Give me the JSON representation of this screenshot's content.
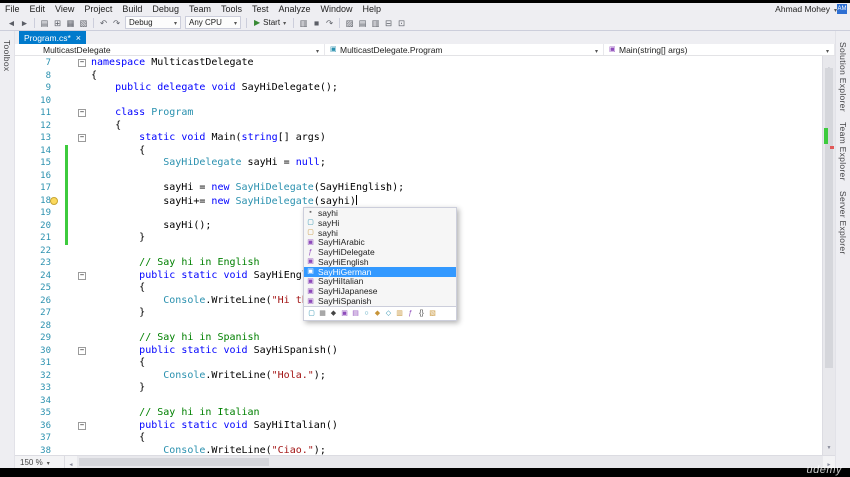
{
  "app": {
    "user_name": "Ahmad Mohey",
    "avatar_initials": "AM",
    "watermark": "udemy"
  },
  "menu_bar": {
    "items": [
      "File",
      "Edit",
      "View",
      "Project",
      "Build",
      "Debug",
      "Team",
      "Tools",
      "Test",
      "Analyze",
      "Window",
      "Help"
    ]
  },
  "toolbar": {
    "debug_target": "Debug",
    "platform": "Any CPU",
    "start_label": "Start",
    "icon_groups": {
      "nav": [
        {
          "name": "nav-back",
          "glyph": "◄"
        },
        {
          "name": "nav-forward",
          "glyph": "►"
        }
      ],
      "file": [
        {
          "name": "new-file",
          "glyph": "▤"
        },
        {
          "name": "open-file",
          "glyph": "⊞"
        },
        {
          "name": "save",
          "glyph": "▦"
        },
        {
          "name": "save-all",
          "glyph": "▧"
        }
      ],
      "edit": [
        {
          "name": "undo",
          "glyph": "↶"
        },
        {
          "name": "redo",
          "glyph": "↷"
        }
      ],
      "after-start": [
        {
          "name": "pause",
          "glyph": "▥"
        },
        {
          "name": "stop",
          "glyph": "■"
        },
        {
          "name": "restart",
          "glyph": "↷"
        }
      ],
      "misc": [
        {
          "name": "find-in-files",
          "glyph": "▨"
        },
        {
          "name": "comment-out",
          "glyph": "▤"
        },
        {
          "name": "uncomment",
          "glyph": "▥"
        },
        {
          "name": "bookmark",
          "glyph": "⊟"
        },
        {
          "name": "navigate-bookmarks",
          "glyph": "⊡"
        }
      ]
    }
  },
  "document_tab": {
    "title": "Program.cs*"
  },
  "breadcrumb": {
    "project": "MulticastDelegate",
    "type": "MulticastDelegate.Program",
    "member": "Main(string[] args)"
  },
  "side_panels": {
    "left": [
      "Toolbox"
    ],
    "right": [
      "Solution Explorer",
      "Team Explorer",
      "Server Explorer"
    ]
  },
  "status": {
    "zoom": "150 %"
  },
  "colors": {
    "accent": "#007acc",
    "keyword": "#0000ff",
    "user_type": "#2b91af",
    "string": "#a31515",
    "comment": "#008000",
    "line_number": "#2b91af",
    "change_bar": "#3dcb3d",
    "selection": "#3399ff"
  },
  "editor": {
    "lines": [
      {
        "n": 7,
        "fold": true,
        "segs": [
          [
            "k",
            "namespace"
          ],
          [
            "p",
            " MulticastDelegate"
          ]
        ]
      },
      {
        "n": 8,
        "segs": [
          [
            "p",
            "{"
          ]
        ]
      },
      {
        "n": 9,
        "segs": [
          [
            "p",
            "    "
          ],
          [
            "k",
            "public"
          ],
          [
            "p",
            " "
          ],
          [
            "k",
            "delegate"
          ],
          [
            "p",
            " "
          ],
          [
            "k",
            "void"
          ],
          [
            "p",
            " SayHiDelegate();"
          ]
        ]
      },
      {
        "n": 10,
        "segs": []
      },
      {
        "n": 11,
        "fold": true,
        "segs": [
          [
            "p",
            "    "
          ],
          [
            "k",
            "class"
          ],
          [
            "p",
            " "
          ],
          [
            "t",
            "Program"
          ]
        ]
      },
      {
        "n": 12,
        "segs": [
          [
            "p",
            "    {"
          ]
        ]
      },
      {
        "n": 13,
        "fold": true,
        "segs": [
          [
            "p",
            "        "
          ],
          [
            "k",
            "static"
          ],
          [
            "p",
            " "
          ],
          [
            "k",
            "void"
          ],
          [
            "p",
            " Main("
          ],
          [
            "k",
            "string"
          ],
          [
            "p",
            "[] args)"
          ]
        ]
      },
      {
        "n": 14,
        "change": true,
        "segs": [
          [
            "p",
            "        {"
          ]
        ]
      },
      {
        "n": 15,
        "change": true,
        "segs": [
          [
            "p",
            "            "
          ],
          [
            "t",
            "SayHiDelegate"
          ],
          [
            "p",
            " sayHi = "
          ],
          [
            "k",
            "null"
          ],
          [
            "p",
            ";"
          ]
        ]
      },
      {
        "n": 16,
        "change": true,
        "segs": []
      },
      {
        "n": 17,
        "change": true,
        "segs": [
          [
            "p",
            "            sayHi = "
          ],
          [
            "k",
            "new"
          ],
          [
            "p",
            " "
          ],
          [
            "t",
            "SayHiDelegate"
          ],
          [
            "p",
            "(SayHiEnglish);"
          ]
        ]
      },
      {
        "n": 18,
        "change": true,
        "bulb": true,
        "caret": true,
        "segs": [
          [
            "p",
            "            sayHi+= "
          ],
          [
            "k",
            "new"
          ],
          [
            "p",
            " "
          ],
          [
            "t",
            "SayHiDelegate"
          ],
          [
            "p",
            "(sayhi)"
          ]
        ]
      },
      {
        "n": 19,
        "change": true,
        "segs": []
      },
      {
        "n": 20,
        "change": true,
        "segs": [
          [
            "p",
            "            sayHi();"
          ]
        ]
      },
      {
        "n": 21,
        "change": true,
        "segs": [
          [
            "p",
            "        }"
          ]
        ]
      },
      {
        "n": 22,
        "segs": []
      },
      {
        "n": 23,
        "segs": [
          [
            "p",
            "        "
          ],
          [
            "c",
            "// Say hi in English"
          ]
        ]
      },
      {
        "n": 24,
        "fold": true,
        "segs": [
          [
            "p",
            "        "
          ],
          [
            "k",
            "public"
          ],
          [
            "p",
            " "
          ],
          [
            "k",
            "static"
          ],
          [
            "p",
            " "
          ],
          [
            "k",
            "void"
          ],
          [
            "p",
            " SayHiEnglish()"
          ]
        ]
      },
      {
        "n": 25,
        "segs": [
          [
            "p",
            "        {"
          ]
        ]
      },
      {
        "n": 26,
        "segs": [
          [
            "p",
            "            "
          ],
          [
            "t",
            "Console"
          ],
          [
            "p",
            ".WriteLine("
          ],
          [
            "s",
            "\"Hi there.\""
          ],
          [
            "p",
            ");"
          ]
        ]
      },
      {
        "n": 27,
        "segs": [
          [
            "p",
            "        }"
          ]
        ]
      },
      {
        "n": 28,
        "segs": []
      },
      {
        "n": 29,
        "segs": [
          [
            "p",
            "        "
          ],
          [
            "c",
            "// Say hi in Spanish"
          ]
        ]
      },
      {
        "n": 30,
        "fold": true,
        "segs": [
          [
            "p",
            "        "
          ],
          [
            "k",
            "public"
          ],
          [
            "p",
            " "
          ],
          [
            "k",
            "static"
          ],
          [
            "p",
            " "
          ],
          [
            "k",
            "void"
          ],
          [
            "p",
            " SayHiSpanish()"
          ]
        ]
      },
      {
        "n": 31,
        "segs": [
          [
            "p",
            "        {"
          ]
        ]
      },
      {
        "n": 32,
        "segs": [
          [
            "p",
            "            "
          ],
          [
            "t",
            "Console"
          ],
          [
            "p",
            ".WriteLine("
          ],
          [
            "s",
            "\"Hola.\""
          ],
          [
            "p",
            ");"
          ]
        ]
      },
      {
        "n": 33,
        "segs": [
          [
            "p",
            "        }"
          ]
        ]
      },
      {
        "n": 34,
        "segs": []
      },
      {
        "n": 35,
        "segs": [
          [
            "p",
            "        "
          ],
          [
            "c",
            "// Say hi in Italian"
          ]
        ]
      },
      {
        "n": 36,
        "fold": true,
        "segs": [
          [
            "p",
            "        "
          ],
          [
            "k",
            "public"
          ],
          [
            "p",
            " "
          ],
          [
            "k",
            "static"
          ],
          [
            "p",
            " "
          ],
          [
            "k",
            "void"
          ],
          [
            "p",
            " SayHiItalian()"
          ]
        ]
      },
      {
        "n": 37,
        "segs": [
          [
            "p",
            "        {"
          ]
        ]
      },
      {
        "n": 38,
        "segs": [
          [
            "p",
            "            "
          ],
          [
            "t",
            "Console"
          ],
          [
            "p",
            ".WriteLine("
          ],
          [
            "s",
            "\"Ciao.\""
          ],
          [
            "p",
            ");"
          ]
        ]
      }
    ]
  },
  "intellisense": {
    "selected": "SayHiGerman",
    "items": [
      {
        "label": "sayhi",
        "icon": "keyword"
      },
      {
        "label": "sayHi",
        "icon": "local"
      },
      {
        "label": "sayhi",
        "icon": "snippet"
      },
      {
        "label": "SayHiArabic",
        "icon": "method"
      },
      {
        "label": "SayHiDelegate",
        "icon": "delegate"
      },
      {
        "label": "SayHiEnglish",
        "icon": "method"
      },
      {
        "label": "SayHiGerman",
        "icon": "method",
        "selected": true
      },
      {
        "label": "SayHiItalian",
        "icon": "method"
      },
      {
        "label": "SayHiJapanese",
        "icon": "method"
      },
      {
        "label": "SayHiSpanish",
        "icon": "method"
      }
    ],
    "filters": [
      {
        "name": "filter-locals-icon",
        "glyph": "▢",
        "color": "#2b91af"
      },
      {
        "name": "filter-constants-icon",
        "glyph": "▦",
        "color": "#777777"
      },
      {
        "name": "filter-properties-icon",
        "glyph": "◆",
        "color": "#444444"
      },
      {
        "name": "filter-methods-icon",
        "glyph": "▣",
        "color": "#8e4bbb"
      },
      {
        "name": "filter-extension-methods-icon",
        "glyph": "▤",
        "color": "#8e4bbb"
      },
      {
        "name": "filter-interfaces-icon",
        "glyph": "○",
        "color": "#2b91af"
      },
      {
        "name": "filter-classes-icon",
        "glyph": "◆",
        "color": "#c79438"
      },
      {
        "name": "filter-structs-icon",
        "glyph": "◇",
        "color": "#2b91af"
      },
      {
        "name": "filter-enums-icon",
        "glyph": "▥",
        "color": "#c79438"
      },
      {
        "name": "filter-delegates-icon",
        "glyph": "ƒ",
        "color": "#8e4bbb"
      },
      {
        "name": "filter-namespaces-icon",
        "glyph": "{}",
        "color": "#444444"
      },
      {
        "name": "filter-snippets-icon",
        "glyph": "▧",
        "color": "#c79438"
      }
    ]
  }
}
